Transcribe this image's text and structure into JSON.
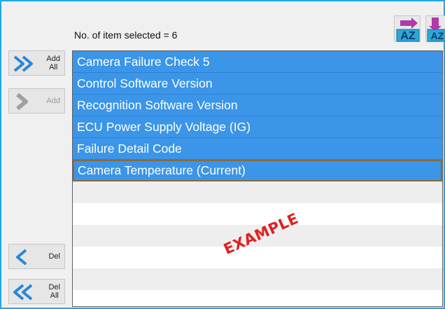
{
  "header": {
    "selected_count_text": "No. of item selected = 6"
  },
  "toolbar": {
    "sort_az": {
      "label": "AZ",
      "icon": "sort-az-icon"
    },
    "sort_za": {
      "label": "AZ",
      "icon": "sort-za-icon"
    }
  },
  "side_buttons": {
    "add_all": {
      "label": "Add\nAll",
      "icon": "double-chevron-right-icon",
      "enabled": true
    },
    "add": {
      "label": "Add",
      "icon": "chevron-right-icon",
      "enabled": false
    },
    "del": {
      "label": "Del",
      "icon": "chevron-left-icon",
      "enabled": true
    },
    "del_all": {
      "label": "Del\nAll",
      "icon": "double-chevron-left-icon",
      "enabled": true
    }
  },
  "list": {
    "items": [
      {
        "label": "Camera Failure Check 5",
        "selected": true
      },
      {
        "label": "Control Software Version",
        "selected": true
      },
      {
        "label": "Recognition Software Version",
        "selected": true
      },
      {
        "label": "ECU Power Supply Voltage (IG)",
        "selected": true
      },
      {
        "label": "Failure Detail Code",
        "selected": true
      },
      {
        "label": "Camera Temperature (Current)",
        "selected": true,
        "focused": true
      }
    ]
  },
  "watermark": "EXAMPLE",
  "colors": {
    "frame_border": "#1ea7e8",
    "selection": "#3b95e8",
    "watermark": "#e02020"
  }
}
